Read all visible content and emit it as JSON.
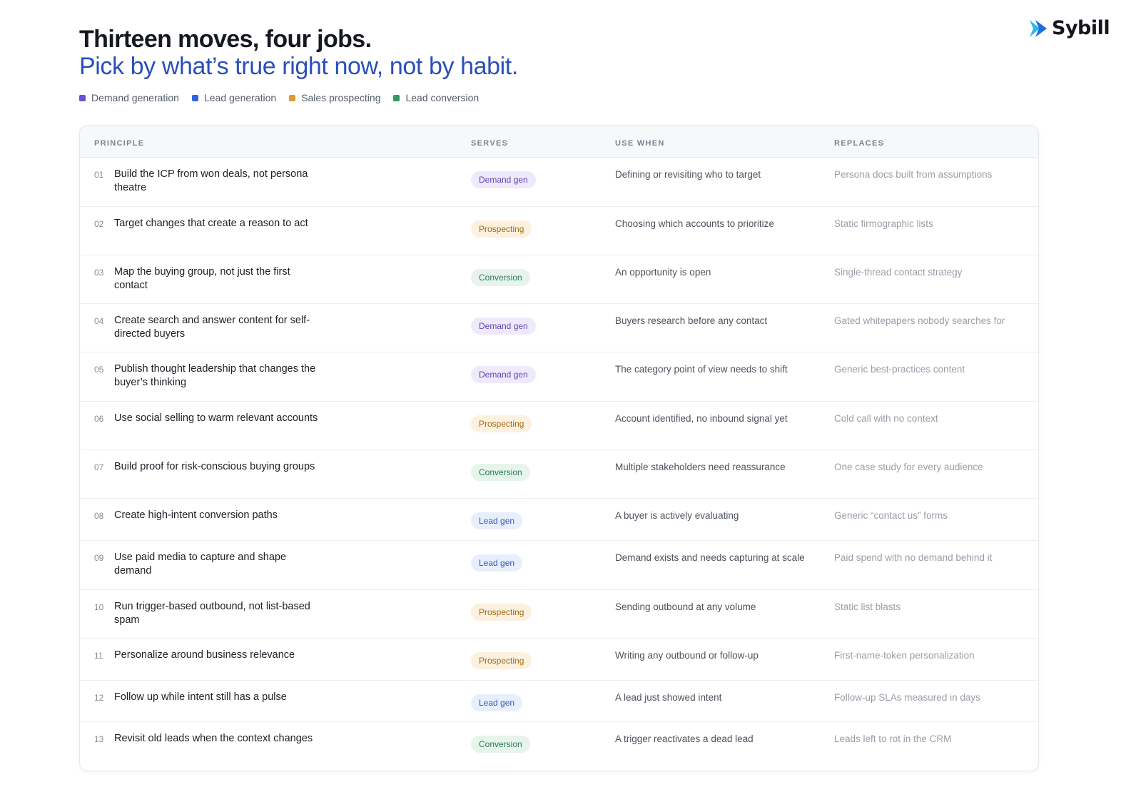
{
  "brand": {
    "name": "Sybill",
    "logo_icon": "sybill-chevron-logo",
    "colors": [
      "#2fb7e8",
      "#1e6fd9"
    ]
  },
  "header": {
    "title": "Thirteen moves, four jobs.",
    "subtitle": "Pick by what’s true right now, not by habit."
  },
  "legend": [
    {
      "label": "Demand generation",
      "color": "#6b4fd6"
    },
    {
      "label": "Lead generation",
      "color": "#2f63e0"
    },
    {
      "label": "Sales prospecting",
      "color": "#e09a2e"
    },
    {
      "label": "Lead conversion",
      "color": "#2f9a63"
    }
  ],
  "badge_styles": {
    "Demand gen": {
      "bg": "#efeafb",
      "fg": "#5a45b8"
    },
    "Prospecting": {
      "bg": "#fcf1de",
      "fg": "#a56a12"
    },
    "Conversion": {
      "bg": "#e6f4ec",
      "fg": "#2b7d51"
    },
    "Lead gen": {
      "bg": "#e8effc",
      "fg": "#2e59c4"
    }
  },
  "table": {
    "headers": {
      "principle": "PRINCIPLE",
      "serves": "SERVES",
      "use_when": "USE WHEN",
      "replaces": "REPLACES"
    },
    "rows": [
      {
        "num": "01",
        "principle": "Build the ICP from won deals, not persona theatre",
        "serves": "Demand gen",
        "use_when": "Defining or revisiting who to target",
        "replaces": "Persona docs built from assumptions"
      },
      {
        "num": "02",
        "principle": "Target changes that create a reason to act",
        "serves": "Prospecting",
        "use_when": "Choosing which accounts to prioritize",
        "replaces": "Static firmographic lists"
      },
      {
        "num": "03",
        "principle": "Map the buying group, not just the first contact",
        "serves": "Conversion",
        "use_when": "An opportunity is open",
        "replaces": "Single-thread contact strategy"
      },
      {
        "num": "04",
        "principle": "Create search and answer content for self-directed buyers",
        "serves": "Demand gen",
        "use_when": "Buyers research before any contact",
        "replaces": "Gated whitepapers nobody searches for"
      },
      {
        "num": "05",
        "principle": "Publish thought leadership that changes the buyer’s thinking",
        "serves": "Demand gen",
        "use_when": "The category point of view needs to shift",
        "replaces": "Generic best-practices content"
      },
      {
        "num": "06",
        "principle": "Use social selling to warm relevant accounts",
        "serves": "Prospecting",
        "use_when": "Account identified, no inbound signal yet",
        "replaces": "Cold call with no context"
      },
      {
        "num": "07",
        "principle": "Build proof for risk-conscious buying groups",
        "serves": "Conversion",
        "use_when": "Multiple stakeholders need reassurance",
        "replaces": "One case study for every audience"
      },
      {
        "num": "08",
        "principle": "Create high-intent conversion paths",
        "serves": "Lead gen",
        "use_when": "A buyer is actively evaluating",
        "replaces": "Generic “contact us” forms"
      },
      {
        "num": "09",
        "principle": "Use paid media to capture and shape demand",
        "serves": "Lead gen",
        "use_when": "Demand exists and needs capturing at scale",
        "replaces": "Paid spend with no demand behind it"
      },
      {
        "num": "10",
        "principle": "Run trigger-based outbound, not list-based spam",
        "serves": "Prospecting",
        "use_when": "Sending outbound at any volume",
        "replaces": "Static list blasts"
      },
      {
        "num": "11",
        "principle": "Personalize around business relevance",
        "serves": "Prospecting",
        "use_when": "Writing any outbound or follow-up",
        "replaces": "First-name-token personalization"
      },
      {
        "num": "12",
        "principle": "Follow up while intent still has a pulse",
        "serves": "Lead gen",
        "use_when": "A lead just showed intent",
        "replaces": "Follow-up SLAs measured in days"
      },
      {
        "num": "13",
        "principle": "Revisit old leads when the context changes",
        "serves": "Conversion",
        "use_when": "A trigger reactivates a dead lead",
        "replaces": "Leads left to rot in the CRM"
      }
    ]
  }
}
